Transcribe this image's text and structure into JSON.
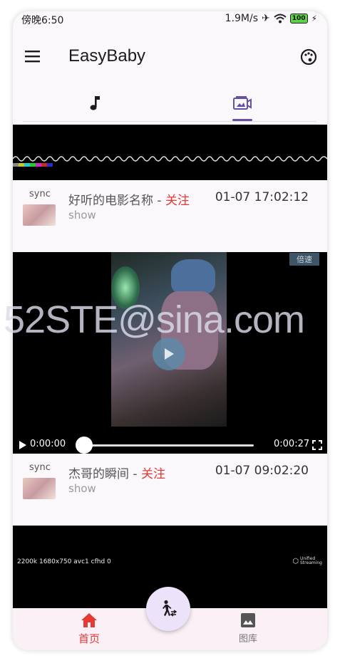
{
  "status_bar": {
    "time": "傍晚6:50",
    "net_speed": "1.9M/s",
    "battery": "100"
  },
  "app_bar": {
    "title": "EasyBaby",
    "menu_icon": "menu-icon",
    "theme_icon": "palette-icon"
  },
  "tabs": [
    {
      "icon": "music-note-icon"
    },
    {
      "icon": "video-gallery-icon",
      "selected": true
    }
  ],
  "feed": [
    {
      "sync": "sync",
      "title": "好听的电影名称",
      "separator": " - ",
      "follow": "关注",
      "subtitle": "show",
      "time": "01-07 17:02:12"
    },
    {
      "sync": "sync",
      "title": "杰哥的瞬间",
      "separator": " - ",
      "follow": "关注",
      "subtitle": "show",
      "time": "01-07 09:02:20"
    }
  ],
  "player": {
    "speed_label": "倍速",
    "current_time": "0:00:00",
    "duration": "0:00:27",
    "progress": 0.0
  },
  "stream_info": {
    "text": "2200k 1680x750 avc1 cfhd 0",
    "logo": "Unified Streaming"
  },
  "watermark": "52STE@sina.com",
  "bottom_nav": [
    {
      "label": "首页",
      "icon": "home-icon",
      "active": true
    },
    {
      "label": "图库",
      "icon": "image-icon",
      "active": false
    }
  ],
  "fab_icon": "walking-person-icon",
  "colors": {
    "accent": "#6750a4",
    "active_nav": "#e53935",
    "follow": "#e53935"
  }
}
